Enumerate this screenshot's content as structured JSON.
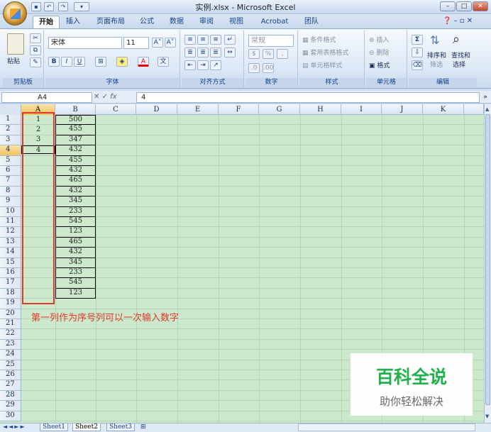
{
  "window": {
    "title": "实例.xlsx - Microsoft Excel",
    "controls": {
      "minimize": "–",
      "maximize": "□",
      "close": "✕"
    }
  },
  "ribbon_tabs": [
    "开始",
    "插入",
    "页面布局",
    "公式",
    "数据",
    "审阅",
    "视图",
    "Acrobat",
    "团队"
  ],
  "ribbon": {
    "clipboard": {
      "paste": "粘贴",
      "label": "剪贴板"
    },
    "font": {
      "name": "宋体",
      "size": "11",
      "bold": "B",
      "italic": "I",
      "underline": "U",
      "label": "字体"
    },
    "alignment": {
      "label": "对齐方式"
    },
    "number": {
      "format": "常规",
      "percent": "%",
      "label": "数字"
    },
    "styles": {
      "conditional": "条件格式",
      "table": "套用表格格式",
      "cell": "单元格样式",
      "label": "样式"
    },
    "cells": {
      "insert": "插入",
      "delete": "删除",
      "format": "格式",
      "label": "单元格"
    },
    "editing": {
      "sum": "Σ",
      "sort": "排序和",
      "filter": "筛选",
      "find": "查找和",
      "select": "选择",
      "label": "编辑"
    }
  },
  "formula_bar": {
    "name_box": "A4",
    "fx": "fx",
    "content": "4"
  },
  "columns": [
    "A",
    "B",
    "C",
    "D",
    "E",
    "F",
    "G",
    "H",
    "I",
    "J",
    "K"
  ],
  "rows": [
    "1",
    "2",
    "3",
    "4",
    "5",
    "6",
    "7",
    "8",
    "9",
    "10",
    "11",
    "12",
    "13",
    "14",
    "15",
    "16",
    "17",
    "18",
    "19",
    "20",
    "21",
    "22",
    "23",
    "24",
    "25",
    "26",
    "27",
    "28",
    "29",
    "30"
  ],
  "column_a": [
    "1",
    "2",
    "3",
    "4"
  ],
  "column_b": [
    "500",
    "455",
    "347",
    "432",
    "455",
    "432",
    "465",
    "432",
    "345",
    "233",
    "545",
    "123",
    "465",
    "432",
    "345",
    "233",
    "545",
    "123"
  ],
  "note": "第一列作为序号列可以一次输入数字",
  "sheets": [
    "Sheet1",
    "Sheet2",
    "Sheet3"
  ],
  "watermark": {
    "title": "百科全说",
    "subtitle": "助你轻松解决"
  },
  "colors": {
    "grid_bg": "#cde9cc",
    "accent_red": "#e3372c",
    "watermark_green": "#20b14a"
  }
}
